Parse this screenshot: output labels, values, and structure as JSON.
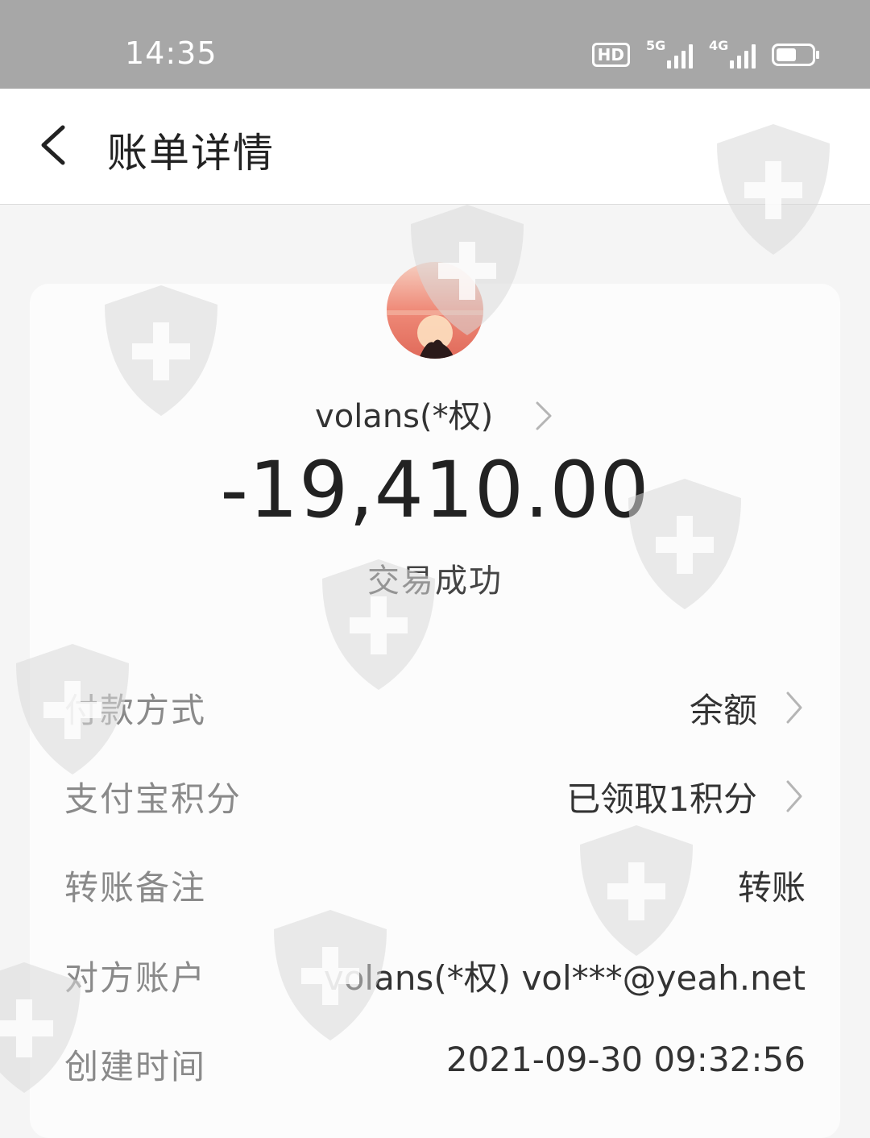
{
  "status_bar": {
    "time": "14:35",
    "hd_label": "HD",
    "signal_1_label": "5G",
    "signal_2_label": "4G",
    "icons": [
      "hd-voice-icon",
      "signal-5g-icon",
      "signal-4g-icon",
      "battery-icon"
    ]
  },
  "header": {
    "title": "账单详情",
    "back_icon": "chevron-left-icon"
  },
  "transaction": {
    "payee": "volans(*权)",
    "amount": "-19,410.00",
    "status": "交易成功"
  },
  "details": [
    {
      "label": "付款方式",
      "value": "余额",
      "has_chevron": true
    },
    {
      "label": "支付宝积分",
      "value": "已领取1积分",
      "has_chevron": true
    },
    {
      "label": "转账备注",
      "value": "转账",
      "has_chevron": false
    },
    {
      "label": "对方账户",
      "value": "volans(*权) vol***@yeah.net",
      "has_chevron": false
    },
    {
      "label": "创建时间",
      "value": "2021-09-30 09:32:56",
      "has_chevron": false
    }
  ],
  "colors": {
    "status_bar": "#a7a7a7",
    "header_bg": "#ffffff",
    "label": "#8a8a8a",
    "value": "#333333",
    "watermark": "#d9d9d9"
  }
}
